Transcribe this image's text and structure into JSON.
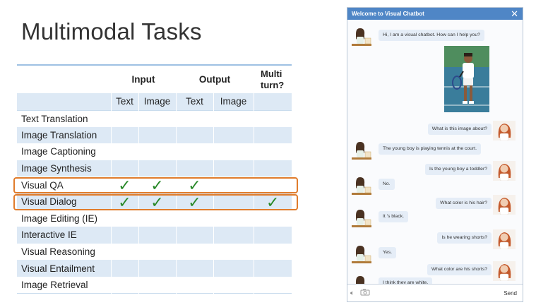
{
  "slide": {
    "title": "Multimodal Tasks"
  },
  "table": {
    "group_headers": [
      "Input",
      "Output",
      "Multi turn?"
    ],
    "sub_headers": [
      "Text",
      "Image",
      "Text",
      "Image"
    ],
    "rows": [
      {
        "task": "Text Translation",
        "checks": [
          false,
          false,
          false,
          false,
          false
        ]
      },
      {
        "task": "Image Translation",
        "checks": [
          false,
          false,
          false,
          false,
          false
        ]
      },
      {
        "task": "Image Captioning",
        "checks": [
          false,
          false,
          false,
          false,
          false
        ]
      },
      {
        "task": "Image Synthesis",
        "checks": [
          false,
          false,
          false,
          false,
          false
        ]
      },
      {
        "task": "Visual QA",
        "checks": [
          true,
          true,
          true,
          false,
          false
        ]
      },
      {
        "task": "Visual Dialog",
        "checks": [
          true,
          true,
          true,
          false,
          true
        ]
      },
      {
        "task": "Image Editing (IE)",
        "checks": [
          false,
          false,
          false,
          false,
          false
        ]
      },
      {
        "task": "Interactive IE",
        "checks": [
          false,
          false,
          false,
          false,
          false
        ]
      },
      {
        "task": "Visual Reasoning",
        "checks": [
          false,
          false,
          false,
          false,
          false
        ]
      },
      {
        "task": "Visual Entailment",
        "checks": [
          false,
          false,
          false,
          false,
          false
        ]
      },
      {
        "task": "Image Retrieval",
        "checks": [
          false,
          false,
          false,
          false,
          false
        ]
      }
    ],
    "check_glyph": "✓",
    "highlighted_rows": [
      "Visual QA",
      "Visual Dialog"
    ]
  },
  "chatbot": {
    "title": "Welcome to Visual Chatbot",
    "close_glyph": "✕",
    "messages": [
      {
        "from": "bot",
        "text": "Hi, I am a visual chatbot. How can I help you?"
      },
      {
        "from": "user",
        "text": "What is this image about?"
      },
      {
        "from": "bot",
        "text": "The young boy is playing tennis at the court."
      },
      {
        "from": "user",
        "text": "Is the young boy a toddler?"
      },
      {
        "from": "bot",
        "text": "No."
      },
      {
        "from": "user",
        "text": "What color is his hair?"
      },
      {
        "from": "bot",
        "text": "It 's black."
      },
      {
        "from": "user",
        "text": "Is he wearing shorts?"
      },
      {
        "from": "bot",
        "text": "Yes."
      },
      {
        "from": "user",
        "text": "What color are his shorts?"
      },
      {
        "from": "bot",
        "text": "I think they are white."
      }
    ],
    "footer": {
      "send_label": "Send",
      "icons": [
        "speaker-icon",
        "camera-icon"
      ]
    }
  },
  "colors": {
    "table_shade": "#dde9f5",
    "check": "#2b8a2b",
    "highlight": "#e07c2c",
    "chat_header": "#4f86c6",
    "bubble": "#e5edf7"
  }
}
